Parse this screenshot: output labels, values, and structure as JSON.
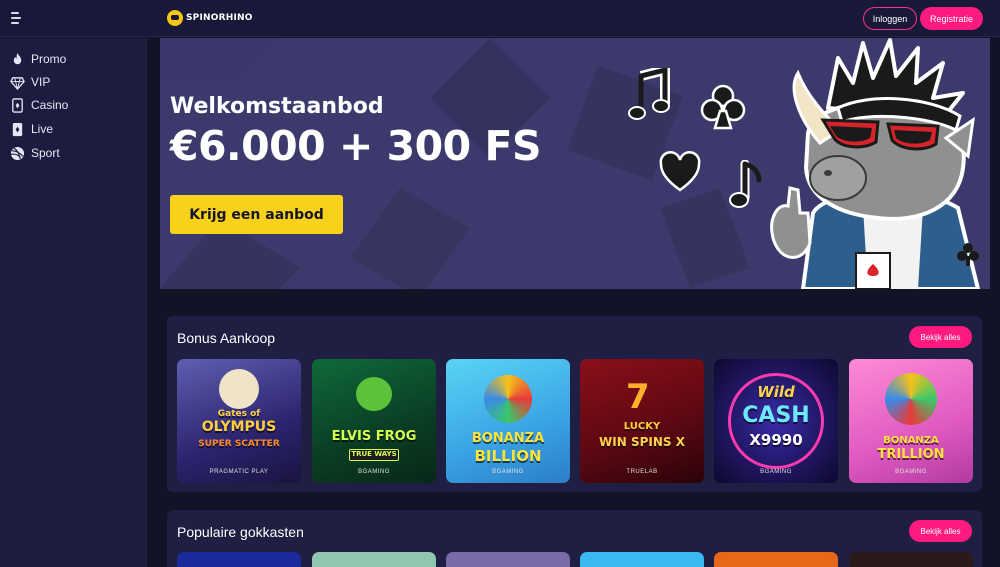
{
  "header": {
    "logo_text": "SPINORHINO",
    "login_label": "Inloggen",
    "register_label": "Registratie"
  },
  "sidebar": {
    "items": [
      {
        "label": "Promo",
        "icon": "flame-icon"
      },
      {
        "label": "VIP",
        "icon": "diamond-icon"
      },
      {
        "label": "Casino",
        "icon": "card-icon"
      },
      {
        "label": "Live",
        "icon": "live-card-icon"
      },
      {
        "label": "Sport",
        "icon": "ball-icon"
      }
    ]
  },
  "hero": {
    "subtitle": "Welkomstaanbod",
    "title": "€6.000 + 300 FS",
    "cta_label": "Krijg een aanbod"
  },
  "sections": [
    {
      "title": "Bonus Aankoop",
      "see_all_label": "Bekijk alles",
      "games": [
        {
          "name_line1": "Gates of",
          "name_line2": "OLYMPUS",
          "name_line3": "SUPER SCATTER",
          "provider": "PRAGMATIC PLAY"
        },
        {
          "name_line1": "ELVIS FROG",
          "name_line2": "TRUE WAYS",
          "provider": "BGAMING"
        },
        {
          "name_line1": "BONANZA",
          "name_line2": "BILLION",
          "provider": "BGAMING"
        },
        {
          "name_line1": "LUCKY",
          "name_line2": "WIN SPINS X",
          "provider": "TRUELAB"
        },
        {
          "name_line1": "Wild",
          "name_line2": "CASH",
          "name_line3": "X9990",
          "provider": "BGAMING"
        },
        {
          "name_line1": "BONANZA",
          "name_line2": "TRILLION",
          "provider": "BGAMING"
        }
      ]
    },
    {
      "title": "Populaire gokkasten",
      "see_all_label": "Bekijk alles"
    }
  ],
  "colors": {
    "accent_pink": "#ff1a7f",
    "cta_yellow": "#f8d21a",
    "sidebar_bg": "#1b1c3f",
    "page_bg": "#121326"
  }
}
